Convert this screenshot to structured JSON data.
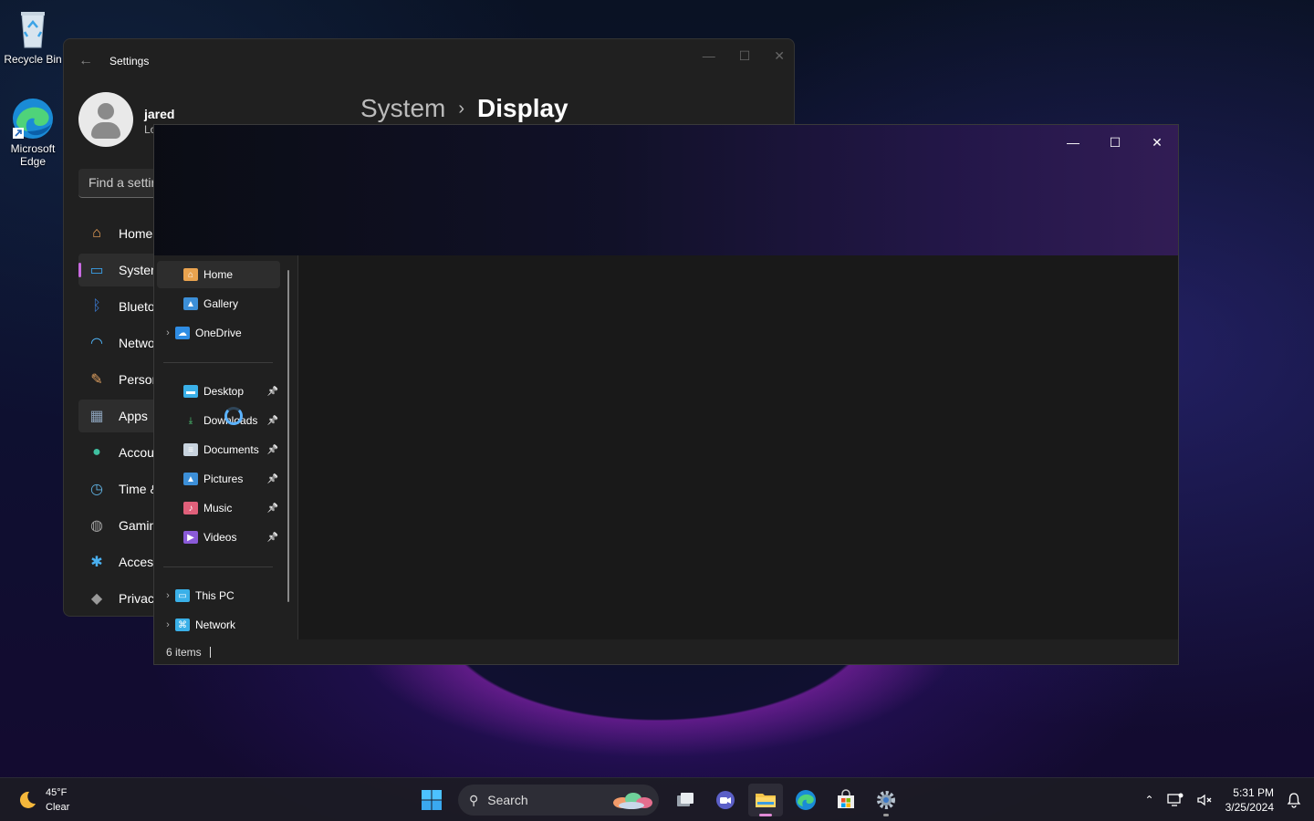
{
  "desktop": {
    "icons": [
      {
        "label": "Recycle Bin",
        "icon": "recycle-bin-icon"
      },
      {
        "label": "Microsoft Edge",
        "icon": "edge-icon"
      }
    ]
  },
  "settings": {
    "title": "Settings",
    "user": {
      "name": "jared",
      "sub": "Lo"
    },
    "breadcrumb": {
      "parent": "System",
      "separator": "›",
      "current": "Display"
    },
    "search_placeholder": "Find a settir",
    "nav": [
      {
        "label": "Home",
        "icon": "home-icon",
        "color": "#f2a65a"
      },
      {
        "label": "Systen",
        "icon": "system-icon",
        "color": "#3aa0e8"
      },
      {
        "label": "Blueto",
        "icon": "bluetooth-icon",
        "color": "#3a7bd5"
      },
      {
        "label": "Netwo",
        "icon": "wifi-icon",
        "color": "#4fb3f6"
      },
      {
        "label": "Person",
        "icon": "brush-icon",
        "color": "#e0a060"
      },
      {
        "label": "Apps",
        "icon": "apps-icon",
        "color": "#8aa0b8"
      },
      {
        "label": "Accou",
        "icon": "account-icon",
        "color": "#3fc0a0"
      },
      {
        "label": "Time &",
        "icon": "clock-icon",
        "color": "#5fb0e0"
      },
      {
        "label": "Gamin",
        "icon": "gamepad-icon",
        "color": "#a0a0a0"
      },
      {
        "label": "Access",
        "icon": "accessibility-icon",
        "color": "#4ab0f0"
      },
      {
        "label": "Privac",
        "icon": "shield-icon",
        "color": "#9a9a9a"
      }
    ]
  },
  "explorer": {
    "nav_items": [
      {
        "label": "Home",
        "icon": "home-icon",
        "chevron": false,
        "pinned": false
      },
      {
        "label": "Gallery",
        "icon": "gallery-icon",
        "chevron": false,
        "pinned": false
      },
      {
        "label": "OneDrive",
        "icon": "onedrive-icon",
        "chevron": true,
        "pinned": false
      },
      {
        "label": "Desktop",
        "icon": "desktop-icon",
        "chevron": false,
        "pinned": true
      },
      {
        "label": "Downloads",
        "icon": "downloads-icon",
        "chevron": false,
        "pinned": true
      },
      {
        "label": "Documents",
        "icon": "documents-icon",
        "chevron": false,
        "pinned": true
      },
      {
        "label": "Pictures",
        "icon": "pictures-icon",
        "chevron": false,
        "pinned": true
      },
      {
        "label": "Music",
        "icon": "music-icon",
        "chevron": false,
        "pinned": true
      },
      {
        "label": "Videos",
        "icon": "videos-icon",
        "chevron": false,
        "pinned": true
      },
      {
        "label": "This PC",
        "icon": "this-pc-icon",
        "chevron": true,
        "pinned": false
      },
      {
        "label": "Network",
        "icon": "network-icon",
        "chevron": true,
        "pinned": false
      }
    ],
    "status": "6 items"
  },
  "taskbar": {
    "weather": {
      "temp": "45°F",
      "condition": "Clear"
    },
    "search_label": "Search",
    "clock": {
      "time": "5:31 PM",
      "date": "3/25/2024"
    }
  }
}
